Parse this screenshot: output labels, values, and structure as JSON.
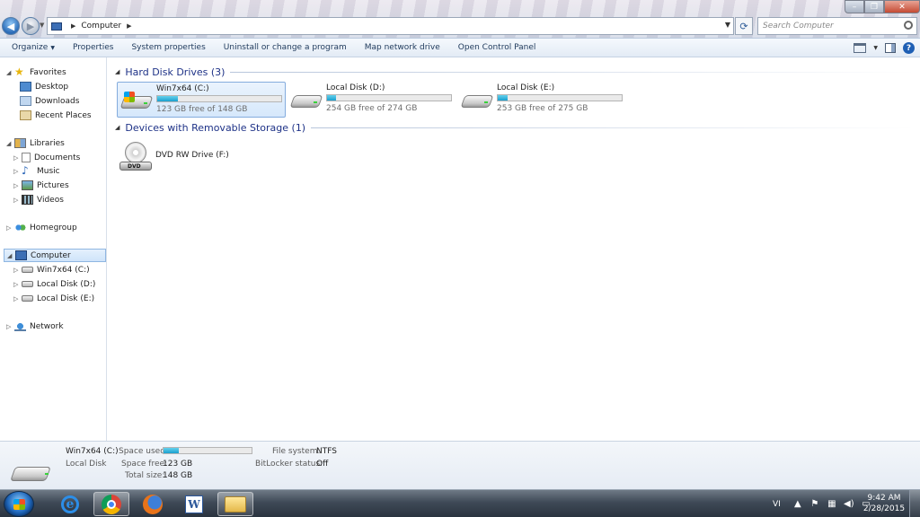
{
  "address": {
    "path": "Computer"
  },
  "search": {
    "placeholder": "Search Computer"
  },
  "toolbar": {
    "organize": "Organize",
    "properties": "Properties",
    "system_properties": "System properties",
    "uninstall": "Uninstall or change a program",
    "map_drive": "Map network drive",
    "control_panel": "Open Control Panel"
  },
  "nav": {
    "favorites": "Favorites",
    "desktop": "Desktop",
    "downloads": "Downloads",
    "recent_places": "Recent Places",
    "libraries": "Libraries",
    "documents": "Documents",
    "music": "Music",
    "pictures": "Pictures",
    "videos": "Videos",
    "homegroup": "Homegroup",
    "computer": "Computer",
    "drive_c": "Win7x64 (C:)",
    "drive_d": "Local Disk (D:)",
    "drive_e": "Local Disk (E:)",
    "network": "Network"
  },
  "content": {
    "hdd_header": "Hard Disk Drives (3)",
    "removable_header": "Devices with Removable Storage (1)",
    "drives": [
      {
        "name": "Win7x64 (C:)",
        "free_text": "123 GB free of 148 GB",
        "used_fraction": 0.17
      },
      {
        "name": "Local Disk (D:)",
        "free_text": "254 GB free of 274 GB",
        "used_fraction": 0.07
      },
      {
        "name": "Local Disk (E:)",
        "free_text": "253 GB free of 275 GB",
        "used_fraction": 0.08
      }
    ],
    "dvd": {
      "name": "DVD RW Drive (F:)",
      "icon_text": "DVD"
    }
  },
  "details": {
    "name": "Win7x64 (C:)",
    "type": "Local Disk",
    "space_used_label": "Space used:",
    "space_used_fraction": 0.17,
    "space_free_label": "Space free:",
    "space_free": "123 GB",
    "total_size_label": "Total size:",
    "total_size": "148 GB",
    "fs_label": "File system:",
    "fs": "NTFS",
    "bitlocker_label": "BitLocker status:",
    "bitlocker": "Off"
  },
  "taskbar": {
    "lang": "VI",
    "time": "9:42 AM",
    "date": "2/28/2015"
  },
  "colors": {
    "accent": "#1e3287",
    "bar_fill": "#1a9fcf",
    "selection": "#d6e8fb"
  }
}
